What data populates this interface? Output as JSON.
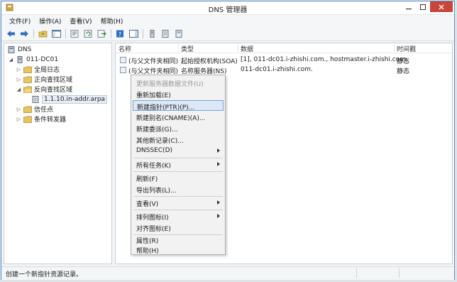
{
  "window": {
    "title": "DNS 管理器"
  },
  "menubar": {
    "items": [
      "文件(F)",
      "操作(A)",
      "查看(V)",
      "帮助(H)"
    ]
  },
  "tree": {
    "root": "DNS",
    "server": "011-DC01",
    "global_logs": "全局日志",
    "forward_zones": "正向查找区域",
    "reverse_zones": "反向查找区域",
    "selected_zone": "1.1.10.in-addr.arpa",
    "trust_points": "信任点",
    "conditional_forwarders": "条件转发器"
  },
  "list": {
    "headers": [
      "名称",
      "类型",
      "数据",
      "时间戳"
    ],
    "rows": [
      {
        "name": "(与父文件夹相同)",
        "type": "起始授权机构(SOA)",
        "data": "[1], 011-dc01.i-zhishi.com., hostmaster.i-zhishi.com.",
        "timestamp": "静态"
      },
      {
        "name": "(与父文件夹相同)",
        "type": "名称服务器(NS)",
        "data": "011-dc01.i-zhishi.com.",
        "timestamp": "静态"
      }
    ]
  },
  "context_menu": {
    "update_server_data": "更新服务器数据文件(U)",
    "reload": "重新加载(E)",
    "new_ptr": "新建指针(PTR)(P)...",
    "new_cname": "新建别名(CNAME)(A)...",
    "new_delegation": "新建委派(G)...",
    "other_records": "其他新记录(C)...",
    "dnssec": "DNSSEC(D)",
    "all_tasks": "所有任务(K)",
    "refresh": "刷新(F)",
    "export_list": "导出列表(L)...",
    "view": "查看(V)",
    "arrange_icons": "排列图标(I)",
    "line_up_icons": "对齐图标(E)",
    "properties": "属性(R)",
    "help": "帮助(H)"
  },
  "status": {
    "text": "创建一个新指针资源记录。"
  },
  "icons": {
    "app": "dns-manager-icon",
    "folder": "folder-icon",
    "server": "server-icon",
    "zone": "zone-icon"
  },
  "colors": {
    "close_button": "#c9443b",
    "selection": "#dde8f6",
    "accent": "#5a8cc8"
  }
}
